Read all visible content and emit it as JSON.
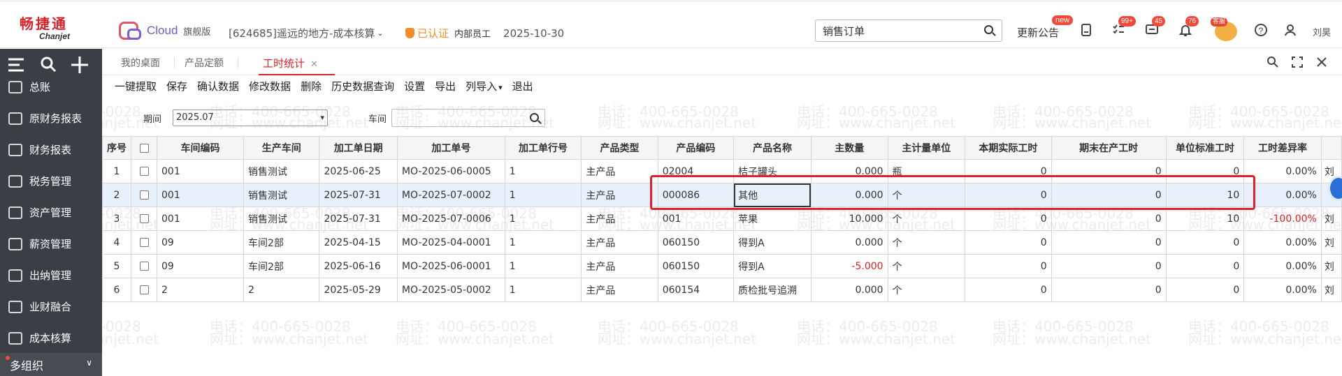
{
  "header": {
    "logo_cn": "畅捷通",
    "logo_en": "Chanjet",
    "product": "Cloud",
    "edition": "旗舰版",
    "company": "[624685]遥远的地方-成本核算",
    "cert_status": "已认证",
    "staff_type": "内部员工",
    "date": "2025-10-30",
    "search_value": "销售订单",
    "announce_label": "更新公告",
    "announce_badge": "new",
    "badges": {
      "todo": "99+",
      "messages": "45",
      "notifications": "76"
    },
    "service_tag": "客服",
    "user": "刘昊"
  },
  "sidebar": {
    "items": [
      {
        "label": "总账",
        "icon": "ledger-icon"
      },
      {
        "label": "原财务报表",
        "icon": "report-icon"
      },
      {
        "label": "财务报表",
        "icon": "chart-icon"
      },
      {
        "label": "税务管理",
        "icon": "tax-icon"
      },
      {
        "label": "资产管理",
        "icon": "bank-icon"
      },
      {
        "label": "薪资管理",
        "icon": "salary-icon"
      },
      {
        "label": "出纳管理",
        "icon": "cashier-icon"
      },
      {
        "label": "业财融合",
        "icon": "integration-icon"
      },
      {
        "label": "成本核算",
        "icon": "cost-icon"
      }
    ],
    "org_switch": "多组织"
  },
  "tabs": [
    {
      "label": "我的桌面"
    },
    {
      "label": "产品定额"
    },
    {
      "label": "工时统计",
      "active": true
    }
  ],
  "toolbar": [
    "一键提取",
    "保存",
    "确认数据",
    "修改数据",
    "删除",
    "历史数据查询",
    "设置",
    "导出",
    "列导入",
    "退出"
  ],
  "filters": {
    "period_label": "期间",
    "period_value": "2025.07",
    "workshop_label": "车间",
    "workshop_value": ""
  },
  "table": {
    "columns": [
      "序号",
      "",
      "车间编码",
      "生产车间",
      "加工单日期",
      "加工单号",
      "加工单行号",
      "产品类型",
      "产品编码",
      "产品名称",
      "主数量",
      "主计量单位",
      "本期实际工时",
      "期末在产工时",
      "单位标准工时",
      "工时差异率"
    ],
    "rows": [
      [
        "1",
        "",
        "001",
        "销售测试",
        "2025-06-25",
        "MO-2025-06-0005",
        "1",
        "主产品",
        "02004",
        "桔子罐头",
        "0.000",
        "瓶",
        "0",
        "0",
        "0",
        "0.00%",
        "刘"
      ],
      [
        "2",
        "",
        "001",
        "销售测试",
        "2025-07-31",
        "MO-2025-07-0002",
        "1",
        "主产品",
        "000086",
        "其他",
        "0.000",
        "个",
        "0",
        "0",
        "10",
        "0.00%",
        ""
      ],
      [
        "3",
        "",
        "001",
        "销售测试",
        "2025-07-31",
        "MO-2025-07-0006",
        "1",
        "主产品",
        "001",
        "苹果",
        "10.000",
        "个",
        "0",
        "0",
        "10",
        "-100.00%",
        "刘"
      ],
      [
        "4",
        "",
        "09",
        "车间2部",
        "2025-04-15",
        "MO-2025-04-0001",
        "1",
        "主产品",
        "060150",
        "得到A",
        "0.000",
        "个",
        "0",
        "0",
        "0",
        "0.00%",
        "刘"
      ],
      [
        "5",
        "",
        "09",
        "车间2部",
        "2025-06-16",
        "MO-2025-06-0001",
        "1",
        "主产品",
        "060150",
        "得到A",
        "-5.000",
        "个",
        "0",
        "0",
        "0",
        "0.00%",
        "刘"
      ],
      [
        "6",
        "",
        "2",
        "2",
        "2025-05-29",
        "MO-2025-05-0002",
        "1",
        "主产品",
        "060154",
        "质检批号追溯",
        "0.000",
        "个",
        "0",
        "0",
        "0",
        "0.00%",
        "刘"
      ]
    ],
    "selected_row": 1
  },
  "watermark": {
    "phone": "电话：400-665-0028",
    "site": "网址：www.chanjet.net"
  },
  "colors": {
    "brand_red": "#d8232a",
    "sidebar_bg": "#3b3f45",
    "badge_red": "#f24a3a",
    "cert_orange": "#f08d2a",
    "highlight_frame": "#e0202a",
    "selected_row_bg": "#e7f0fb"
  }
}
